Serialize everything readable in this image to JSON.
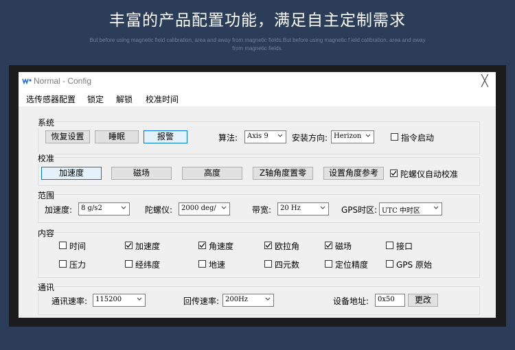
{
  "banner": {
    "title": "丰富的产品配置功能，满足自主定制需求",
    "subtitle": "But before using magnetic field calibration, area and away from magnetic fields.But before using magnetic f ield calibration, area and away from magnetic fields."
  },
  "window": {
    "title": "Normal - Config",
    "close_glyph": "╳"
  },
  "menu": [
    "选传感器配置",
    "锁定",
    "解锁",
    "校准时间"
  ],
  "system": {
    "label": "系统",
    "buttons": [
      "恢复设置",
      "睡眠",
      "报警"
    ],
    "algo_label": "算法:",
    "algo_value": "Axis 9",
    "direction_label": "安装方向:",
    "direction_value": "Herizon",
    "cmd_start_label": "指令启动",
    "cmd_start_checked": false
  },
  "calibrate": {
    "label": "校准",
    "buttons": [
      "加速度",
      "磁场",
      "高度",
      "Z轴角度置零",
      "设置角度参考"
    ],
    "gyro_auto_label": "陀螺仪自动校准",
    "gyro_auto_checked": true
  },
  "range": {
    "label": "范围",
    "accel_label": "加速度:",
    "accel_value": "8   g/s2",
    "gyro_label": "陀螺仪:",
    "gyro_value": "2000 deg/",
    "bandwidth_label": "带宽:",
    "bandwidth_value": "20   Hz",
    "gps_tz_label": "GPS时区:",
    "gps_tz_value": "UTC  中时区"
  },
  "content": {
    "label": "内容",
    "row1": [
      {
        "label": "时间",
        "checked": false
      },
      {
        "label": "加速度",
        "checked": true
      },
      {
        "label": "角速度",
        "checked": true
      },
      {
        "label": "欧拉角",
        "checked": true
      },
      {
        "label": "磁场",
        "checked": true
      },
      {
        "label": "接口",
        "checked": false
      }
    ],
    "row2": [
      {
        "label": "压力",
        "checked": false
      },
      {
        "label": "经纬度",
        "checked": false
      },
      {
        "label": "地速",
        "checked": false
      },
      {
        "label": "四元数",
        "checked": false
      },
      {
        "label": "定位精度",
        "checked": false
      },
      {
        "label": "GPS 原始",
        "checked": false
      }
    ]
  },
  "comm": {
    "label": "通讯",
    "baud_label": "通讯速率:",
    "baud_value": "115200",
    "return_rate_label": "回传速率:",
    "return_rate_value": "200Hz",
    "address_label": "设备地址:",
    "address_value": "0x50",
    "change_button": "更改"
  }
}
